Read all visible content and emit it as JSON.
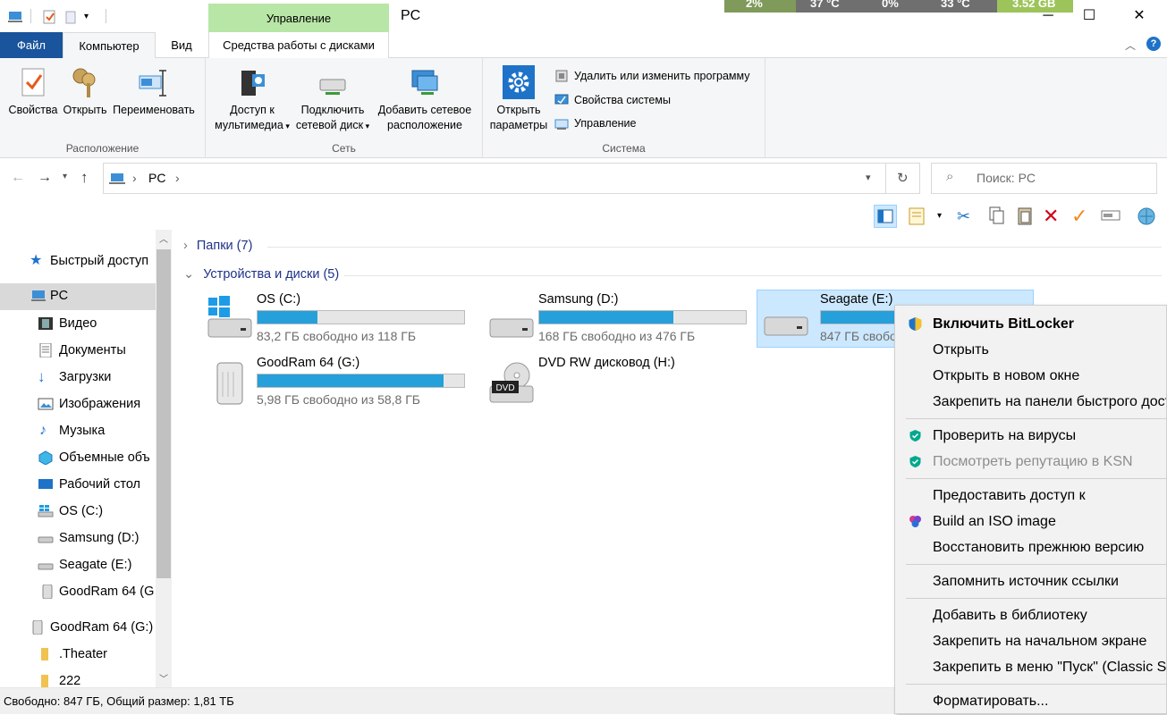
{
  "titlebar": {
    "title": "PC",
    "context_tab_header": "Управление",
    "system_monitor": [
      "2%",
      "37 °C",
      "0%",
      "33 °C",
      "3.52 GB"
    ]
  },
  "tabs": {
    "file": "Файл",
    "computer": "Компьютер",
    "view": "Вид",
    "disk_tools": "Средства работы с дисками"
  },
  "ribbon": {
    "location": {
      "label": "Расположение",
      "properties": "Свойства",
      "open": "Открыть",
      "rename": "Переименовать"
    },
    "network": {
      "label": "Сеть",
      "media_line1": "Доступ к",
      "media_line2": "мультимедиа",
      "map_line1": "Подключить",
      "map_line2": "сетевой диск",
      "add_line1": "Добавить сетевое",
      "add_line2": "расположение"
    },
    "system": {
      "label": "Система",
      "settings_line1": "Открыть",
      "settings_line2": "параметры",
      "uninstall": "Удалить или изменить программу",
      "system_props": "Свойства системы",
      "manage": "Управление"
    }
  },
  "address": {
    "path_item": "PC",
    "search_placeholder": "Поиск: PC"
  },
  "nav": {
    "items": [
      {
        "label": "Быстрый доступ",
        "icon": "star-icon"
      },
      {
        "label": "PC",
        "icon": "pc-icon"
      },
      {
        "label": "Видео",
        "icon": "video-icon"
      },
      {
        "label": "Документы",
        "icon": "documents-icon"
      },
      {
        "label": "Загрузки",
        "icon": "downloads-icon"
      },
      {
        "label": "Изображения",
        "icon": "pictures-icon"
      },
      {
        "label": "Музыка",
        "icon": "music-icon"
      },
      {
        "label": "Объемные объ",
        "icon": "3d-objects-icon"
      },
      {
        "label": "Рабочий стол",
        "icon": "desktop-icon"
      },
      {
        "label": "OS (C:)",
        "icon": "windows-drive-icon"
      },
      {
        "label": "Samsung (D:)",
        "icon": "drive-icon"
      },
      {
        "label": "Seagate (E:)",
        "icon": "drive-icon"
      },
      {
        "label": "GoodRam 64 (G",
        "icon": "usb-drive-icon"
      },
      {
        "label": "GoodRam 64 (G:)",
        "icon": "usb-drive-icon"
      },
      {
        "label": ".Theater",
        "icon": "folder-icon"
      },
      {
        "label": "222",
        "icon": "folder-icon"
      }
    ]
  },
  "content": {
    "folders_group": "Папки (7)",
    "devices_group": "Устройства и диски (5)",
    "drives": [
      {
        "name": "OS (C:)",
        "free": "83,2 ГБ свободно из 118 ГБ",
        "used_fraction": 0.29,
        "icon": "windows-drive-icon"
      },
      {
        "name": "Samsung (D:)",
        "free": "168 ГБ свободно из 476 ГБ",
        "used_fraction": 0.65,
        "icon": "drive-icon"
      },
      {
        "name": "Seagate (E:)",
        "free": "847 ГБ свобо",
        "used_fraction": 0.54,
        "icon": "drive-icon",
        "selected": true
      },
      {
        "name": "GoodRam 64 (G:)",
        "free": "5,98 ГБ свободно из 58,8 ГБ",
        "used_fraction": 0.9,
        "icon": "usb-drive-icon"
      },
      {
        "name": "DVD RW дисковод (H:)",
        "free": "",
        "icon": "dvd-drive-icon"
      }
    ]
  },
  "status": {
    "text": "Свободно: 847 ГБ, Общий размер: 1,81 ТБ"
  },
  "context_menu": {
    "items": [
      {
        "label": "Включить BitLocker",
        "icon": "shield-uac-icon",
        "bold": true
      },
      {
        "label": "Открыть"
      },
      {
        "label": "Открыть в новом окне"
      },
      {
        "label": "Закрепить на панели быстрого доступа"
      },
      {
        "label": "Проверить на вирусы",
        "icon": "kaspersky-icon"
      },
      {
        "label": "Посмотреть репутацию в KSN",
        "icon": "kaspersky-icon",
        "disabled": true
      },
      {
        "label": "Предоставить доступ к"
      },
      {
        "label": "Build an ISO image",
        "icon": "iso-icon"
      },
      {
        "label": "Восстановить прежнюю версию"
      },
      {
        "label": "Запомнить источник ссылки"
      },
      {
        "label": "Добавить в библиотеку"
      },
      {
        "label": "Закрепить на начальном экране"
      },
      {
        "label": "Закрепить в меню \"Пуск\" (Classic Shell)"
      },
      {
        "label": "Форматировать..."
      }
    ]
  },
  "colors": {
    "file_tab": "#19549c",
    "context_tab": "#b8e6a6",
    "progress_fill": "#26a0da",
    "selection": "#cce8ff"
  }
}
